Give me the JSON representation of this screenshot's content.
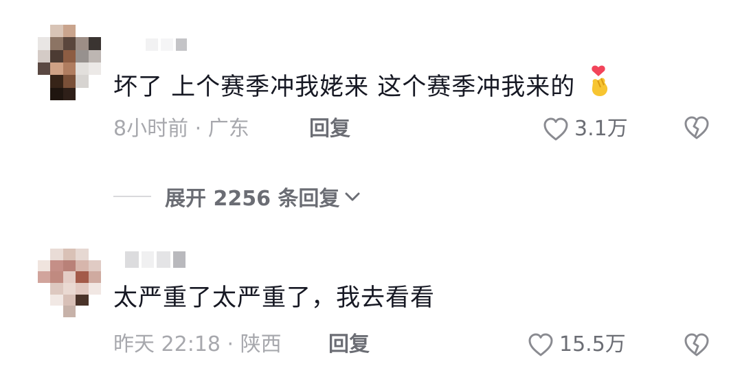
{
  "comments": [
    {
      "text": "坏了 上个赛季冲我姥来 这个赛季冲我来的",
      "emoji": "🫰",
      "time": "8小时前",
      "location": "广东",
      "reply_label": "回复",
      "likes": "3.1万"
    },
    {
      "text": "太严重了太严重了，我去看看",
      "time": "昨天 22:18",
      "location": "陕西",
      "reply_label": "回复",
      "likes": "15.5万"
    }
  ],
  "expand_replies": {
    "label": "展开 2256 条回复"
  },
  "colors": {
    "meta": "#a7a8ad",
    "action": "#6b6d74",
    "text": "#161823"
  },
  "icons": [
    "finger-heart-emoji-icon",
    "heart-outline-icon",
    "broken-heart-icon",
    "chevron-down-icon"
  ]
}
